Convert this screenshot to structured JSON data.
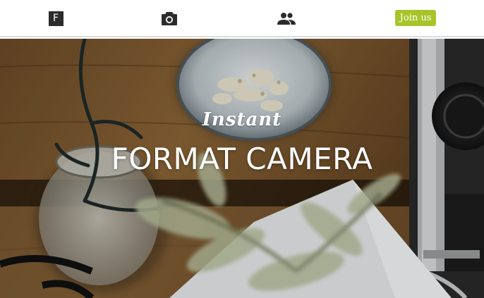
{
  "nav": {
    "logo_letter": "F",
    "join_label": "Join us",
    "icons": [
      "logo-icon",
      "camera-icon",
      "people-icon"
    ]
  },
  "hero": {
    "subtitle": "Instant",
    "title": "FORMAT CAMERA"
  },
  "colors": {
    "accent": "#a7c52a",
    "logo_bg": "#2c2c2c",
    "icon": "#2c2c2c"
  }
}
